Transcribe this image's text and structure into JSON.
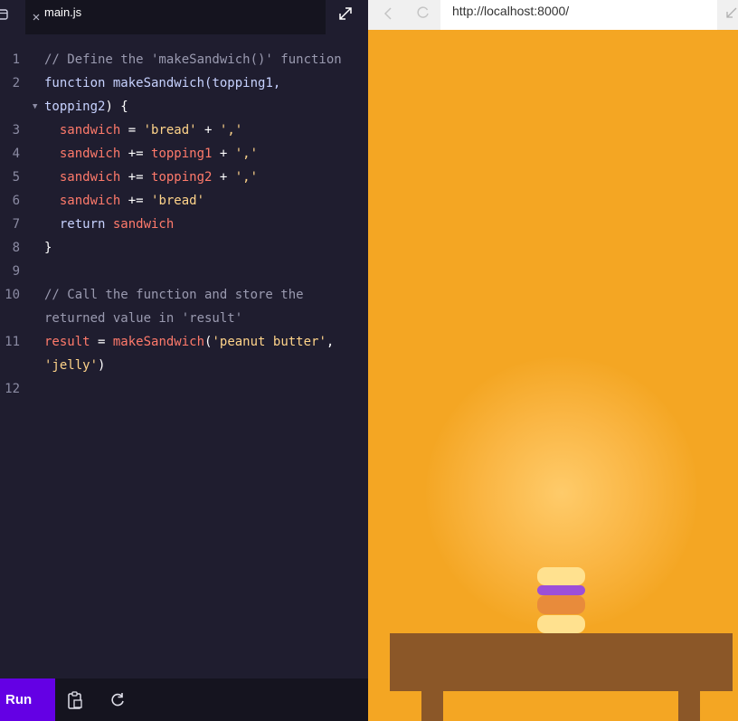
{
  "editor": {
    "tab_name": "main.js",
    "code_lines": [
      {
        "ln": "1",
        "tokens": [
          {
            "t": "// Define the 'makeSandwich()' function",
            "c": "cm"
          }
        ]
      },
      {
        "ln": "2",
        "tokens": [
          {
            "t": "function ",
            "c": "kw"
          },
          {
            "t": "makeSandwich",
            "c": "fn"
          },
          {
            "t": "(topping1,",
            "c": "kw"
          }
        ]
      },
      {
        "ln": "",
        "fold": true,
        "tokens": [
          {
            "t": "topping2",
            "c": "kw"
          },
          {
            "t": ") {",
            "c": "pun"
          }
        ]
      },
      {
        "ln": "3",
        "tokens": [
          {
            "t": "  sandwich",
            "c": "var"
          },
          {
            "t": " = ",
            "c": "pun"
          },
          {
            "t": "'bread'",
            "c": "str"
          },
          {
            "t": " + ",
            "c": "pun"
          },
          {
            "t": "','",
            "c": "str"
          }
        ]
      },
      {
        "ln": "4",
        "tokens": [
          {
            "t": "  sandwich",
            "c": "var"
          },
          {
            "t": " += ",
            "c": "pun"
          },
          {
            "t": "topping1",
            "c": "var"
          },
          {
            "t": " + ",
            "c": "pun"
          },
          {
            "t": "','",
            "c": "str"
          }
        ]
      },
      {
        "ln": "5",
        "tokens": [
          {
            "t": "  sandwich",
            "c": "var"
          },
          {
            "t": " += ",
            "c": "pun"
          },
          {
            "t": "topping2",
            "c": "var"
          },
          {
            "t": " + ",
            "c": "pun"
          },
          {
            "t": "','",
            "c": "str"
          }
        ]
      },
      {
        "ln": "6",
        "tokens": [
          {
            "t": "  sandwich",
            "c": "var"
          },
          {
            "t": " += ",
            "c": "pun"
          },
          {
            "t": "'bread'",
            "c": "str"
          }
        ]
      },
      {
        "ln": "7",
        "tokens": [
          {
            "t": "  return ",
            "c": "kw"
          },
          {
            "t": "sandwich",
            "c": "var"
          }
        ]
      },
      {
        "ln": "8",
        "tokens": [
          {
            "t": "}",
            "c": "pun"
          }
        ]
      },
      {
        "ln": "9",
        "tokens": []
      },
      {
        "ln": "10",
        "tokens": [
          {
            "t": "// Call the function and store the",
            "c": "cm"
          }
        ]
      },
      {
        "ln": "",
        "tokens": [
          {
            "t": "returned value in 'result'",
            "c": "cm"
          }
        ]
      },
      {
        "ln": "11",
        "tokens": [
          {
            "t": "result",
            "c": "var"
          },
          {
            "t": " = ",
            "c": "pun"
          },
          {
            "t": "makeSandwich",
            "c": "var"
          },
          {
            "t": "(",
            "c": "pun"
          },
          {
            "t": "'peanut butter'",
            "c": "str"
          },
          {
            "t": ",",
            "c": "pun"
          }
        ]
      },
      {
        "ln": "",
        "tokens": [
          {
            "t": "'jelly'",
            "c": "str"
          },
          {
            "t": ")",
            "c": "pun"
          }
        ]
      },
      {
        "ln": "12",
        "tokens": []
      }
    ],
    "run_label": "Run"
  },
  "browser": {
    "url": "http://localhost:8000/"
  },
  "colors": {
    "background": "#f4a623",
    "bread": "#ffe18f",
    "jelly": "#9c4fd8",
    "peanut_butter": "#e88b3b",
    "table": "#8b5728",
    "run_button": "#6400e4"
  },
  "icons": [
    "files-icon",
    "close-icon",
    "expand-icon",
    "clipboard-icon",
    "refresh-icon",
    "back-icon",
    "reload-icon",
    "pop-out-icon"
  ]
}
